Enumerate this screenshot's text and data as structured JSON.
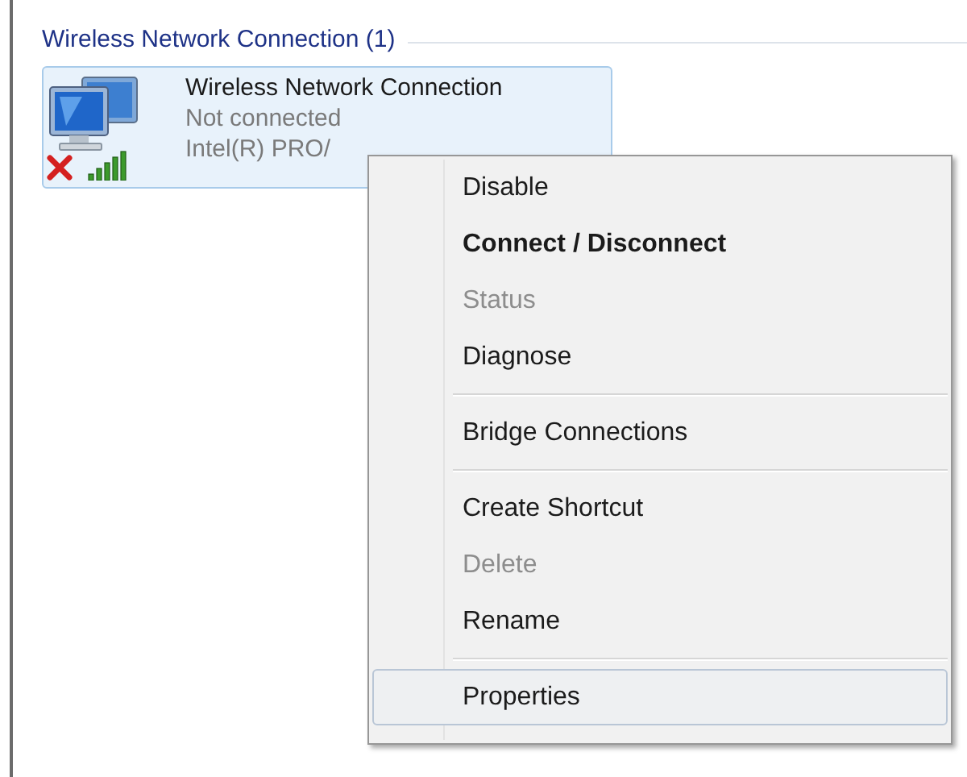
{
  "group": {
    "title": "Wireless Network Connection (1)"
  },
  "connection": {
    "name": "Wireless Network Connection",
    "status": "Not connected",
    "adapter": "Intel(R) PRO/",
    "selected": true,
    "disconnected": true
  },
  "context_menu": {
    "items": [
      {
        "kind": "item",
        "label": "Disable",
        "bold": false,
        "disabled": false,
        "selected": false
      },
      {
        "kind": "item",
        "label": "Connect / Disconnect",
        "bold": true,
        "disabled": false,
        "selected": false
      },
      {
        "kind": "item",
        "label": "Status",
        "bold": false,
        "disabled": true,
        "selected": false
      },
      {
        "kind": "item",
        "label": "Diagnose",
        "bold": false,
        "disabled": false,
        "selected": false
      },
      {
        "kind": "separator"
      },
      {
        "kind": "item",
        "label": "Bridge Connections",
        "bold": false,
        "disabled": false,
        "selected": false
      },
      {
        "kind": "separator"
      },
      {
        "kind": "item",
        "label": "Create Shortcut",
        "bold": false,
        "disabled": false,
        "selected": false
      },
      {
        "kind": "item",
        "label": "Delete",
        "bold": false,
        "disabled": true,
        "selected": false
      },
      {
        "kind": "item",
        "label": "Rename",
        "bold": false,
        "disabled": false,
        "selected": false
      },
      {
        "kind": "separator"
      },
      {
        "kind": "item",
        "label": "Properties",
        "bold": false,
        "disabled": false,
        "selected": true
      }
    ]
  }
}
